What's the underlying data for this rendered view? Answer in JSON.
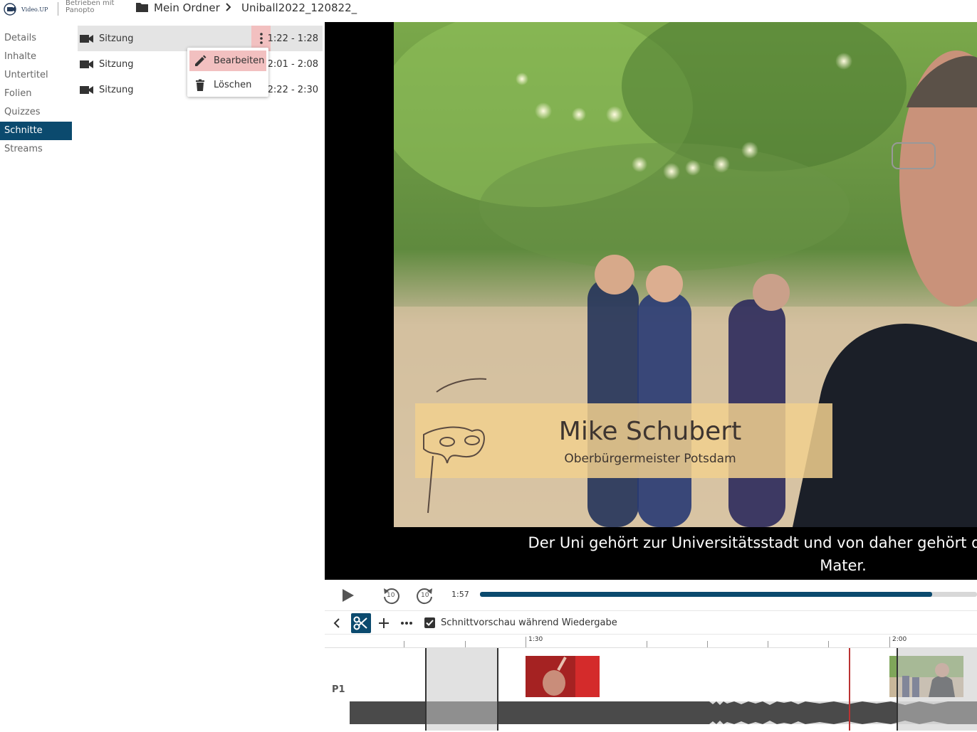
{
  "header": {
    "logo_text": "Video.UP",
    "powered_by": "Betrieben mit",
    "powered_brand": "Panopto",
    "breadcrumb_folder": "Mein Ordner",
    "breadcrumb_session": "Uniball2022_120822_"
  },
  "nav": {
    "items": [
      "Details",
      "Inhalte",
      "Untertitel",
      "Folien",
      "Quizzes",
      "Schnitte",
      "Streams"
    ],
    "active": "Schnitte"
  },
  "cuts": [
    {
      "label": "Sitzung",
      "time": "1:22 - 1:28"
    },
    {
      "label": "Sitzung",
      "time": "2:01 - 2:08"
    },
    {
      "label": "Sitzung",
      "time": "2:22 - 2:30"
    }
  ],
  "context_menu": {
    "edit_label": "Bearbeiten",
    "delete_label": "Löschen"
  },
  "video": {
    "lower_third_name": "Mike Schubert",
    "lower_third_title": "Oberbürgermeister Potsdam",
    "subtitle_line1": "Der Uni gehört zur Universitätsstadt und von daher gehört der Oberbürgermeister d",
    "subtitle_line2": "Mater."
  },
  "player": {
    "timecode": "1:57",
    "progress": 0.91,
    "rewind_label": "10",
    "forward_label": "10"
  },
  "editor": {
    "preview_checkbox_label": "Schnittvorschau während Wiedergabe",
    "preview_checked": true,
    "track_label": "P1",
    "ruler_labels": [
      "1:30",
      "2:00"
    ]
  },
  "colors": {
    "accent": "#0b4a6e",
    "highlight": "#f2c0c0",
    "playhead": "#bb3333"
  }
}
